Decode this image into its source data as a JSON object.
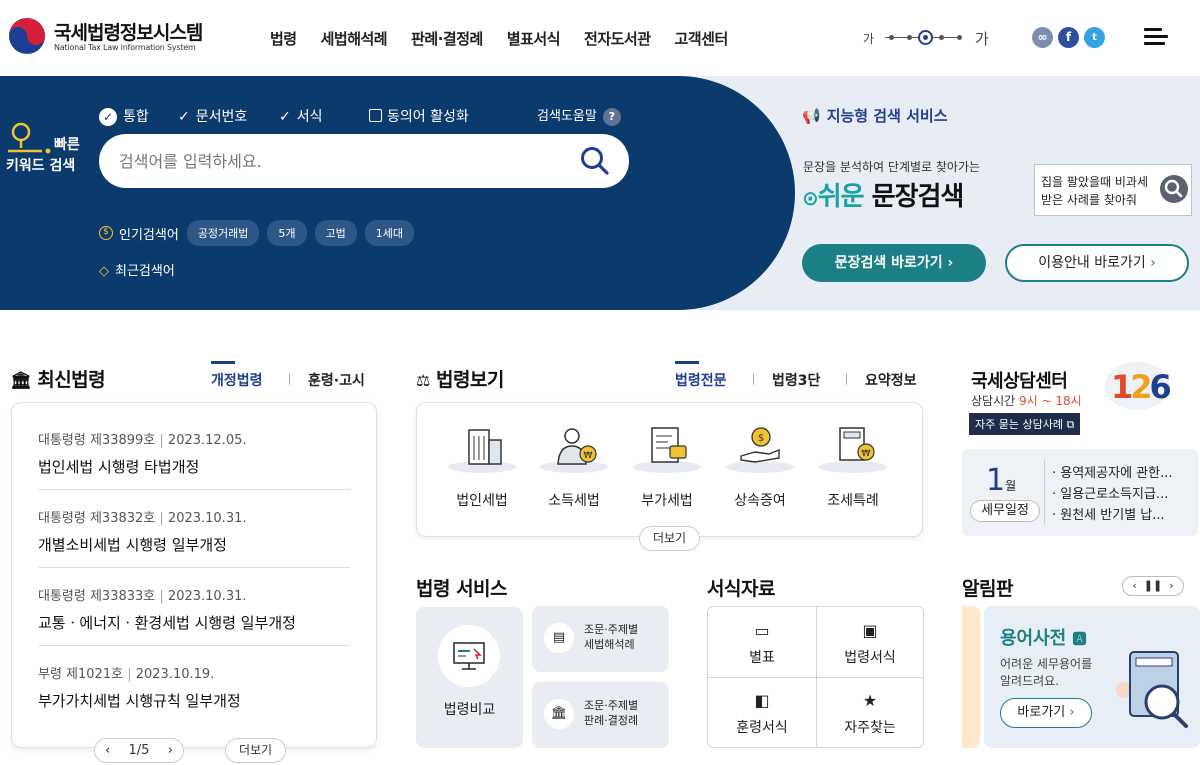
{
  "header": {
    "logo_title": "국세법령정보시스템",
    "logo_sub": "National Tax Law information System",
    "nav": [
      "법령",
      "세법해석례",
      "판례·결정례",
      "별표서식",
      "전자도서관",
      "고객센터"
    ],
    "font_small": "가",
    "font_large": "가",
    "social": [
      "link-icon",
      "facebook-icon",
      "twitter-icon"
    ]
  },
  "search": {
    "quick_label_1": "빠른",
    "quick_label_2": "키워드 검색",
    "options": [
      "통합",
      "문서번호",
      "서식"
    ],
    "synonym": "동의어 활성화",
    "help": "검색도움말",
    "placeholder": "검색어를 입력하세요.",
    "popular_label": "인기검색어",
    "popular_chips": [
      "공정거래법",
      "5개",
      "고법",
      "1세대"
    ],
    "recent_label": "최근검색어"
  },
  "smart": {
    "title": "지능형 검색 서비스",
    "desc": "문장을 분석하여 단계별로 찾아가는",
    "big_easy": "쉬운",
    "big_rest": "문장검색",
    "example": "집을 팔았을때 비과세 받은 사례를 찾아줘",
    "btn_go": "문장검색 바로가기",
    "btn_guide": "이용안내 바로가기"
  },
  "latest": {
    "title": "최신법령",
    "tabs": [
      "개정법령",
      "훈령·고시"
    ],
    "items": [
      {
        "type": "대통령령 제33899호",
        "date": "2023.12.05.",
        "title": "법인세법 시행령 타법개정"
      },
      {
        "type": "대통령령 제33832호",
        "date": "2023.10.31.",
        "title": "개별소비세법 시행령 일부개정"
      },
      {
        "type": "대통령령 제33833호",
        "date": "2023.10.31.",
        "title": "교통ㆍ에너지ㆍ환경세법 시행령 일부개정"
      },
      {
        "type": "부령 제1021호",
        "date": "2023.10.19.",
        "title": "부가가치세법 시행규칙 일부개정"
      }
    ],
    "pager": "1/5",
    "more": "더보기"
  },
  "lawview": {
    "title": "법령보기",
    "tabs": [
      "법령전문",
      "법령3단",
      "요약정보"
    ],
    "items": [
      "법인세법",
      "소득세법",
      "부가세법",
      "상속증여",
      "조세특례"
    ],
    "more": "더보기"
  },
  "service": {
    "title": "법령 서비스",
    "big": "법령비교",
    "small": [
      {
        "l1": "조문·주제별",
        "l2": "세법해석례"
      },
      {
        "l1": "조문·주제별",
        "l2": "판례·결정례"
      }
    ]
  },
  "forms": {
    "title": "서식자료",
    "cells": [
      "별표",
      "법령서식",
      "훈령서식",
      "자주찾는"
    ]
  },
  "consult": {
    "title": "국세상담센터",
    "hours_label": "상담시간",
    "hours": "9시 ~ 18시",
    "number": "126",
    "faq": "자주 묻는 상담사례",
    "month": "1",
    "month_unit": "월",
    "schedule": "세무일정",
    "list": [
      "용역제공자에 관한...",
      "일용근로소득지급...",
      "원천세 반기별 납..."
    ]
  },
  "notice": {
    "title": "알림판",
    "card_title": "용어사전",
    "card_desc_1": "어려운 세무용어를",
    "card_desc_2": "알려드려요.",
    "card_btn": "바로가기"
  },
  "colors": {
    "navy": "#0b3a6c",
    "teal": "#1b7f86",
    "accent_blue": "#1d3e8f",
    "hours_red": "#e04a2c"
  }
}
